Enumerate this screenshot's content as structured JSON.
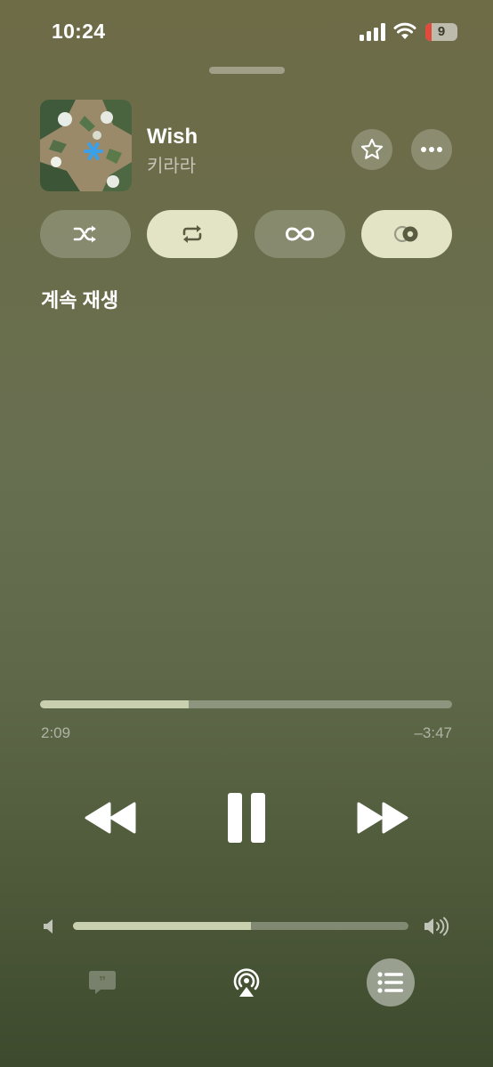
{
  "status_bar": {
    "time": "10:24",
    "battery_level": "9"
  },
  "now_playing": {
    "title": "Wish",
    "artist": "키라라"
  },
  "modes": [
    {
      "name": "shuffle",
      "icon": "shuffle-icon",
      "active": false
    },
    {
      "name": "repeat",
      "icon": "repeat-icon",
      "active": true
    },
    {
      "name": "infinity",
      "icon": "infinity-icon",
      "active": false
    },
    {
      "name": "autoplay",
      "icon": "autoplay-icon",
      "active": true
    }
  ],
  "queue": {
    "section_title": "계속 재생"
  },
  "playback": {
    "elapsed": "2:09",
    "remaining": "–3:47",
    "progress": 0.36
  },
  "volume": {
    "level": 0.53
  },
  "colors": {
    "accent_pill": "#e3e3c6",
    "progress_fill": "#c9d0b0",
    "battery_low": "#e24a3b"
  }
}
